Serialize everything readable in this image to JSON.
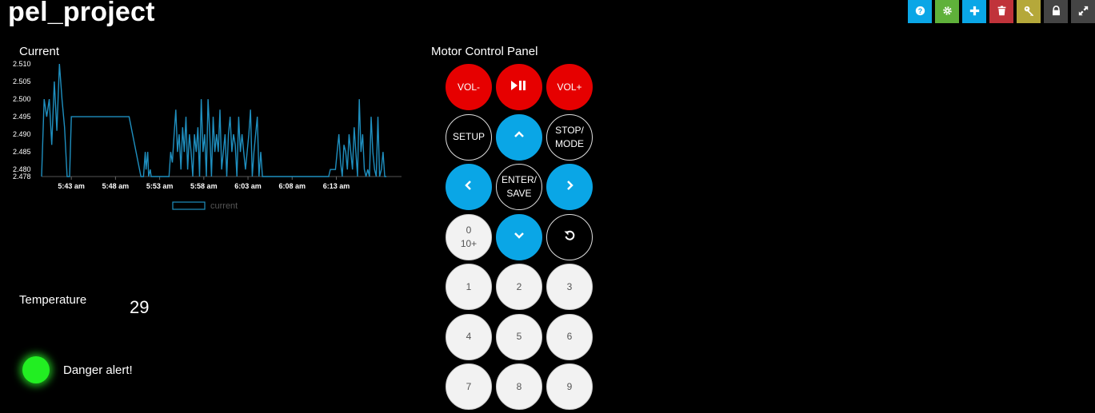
{
  "app": {
    "title": "pel_project"
  },
  "toolbar": [
    {
      "name": "help-button",
      "icon": "help-icon",
      "color": "#0aa6e6"
    },
    {
      "name": "settings-button",
      "icon": "gear-icon",
      "color": "#5fb13a"
    },
    {
      "name": "add-button",
      "icon": "plus-icon",
      "color": "#0aa6e6"
    },
    {
      "name": "delete-button",
      "icon": "trash-icon",
      "color": "#c0333a"
    },
    {
      "name": "key-button",
      "icon": "key-icon",
      "color": "#b5a83a"
    },
    {
      "name": "lock-button",
      "icon": "lock-icon",
      "color": "#444444"
    },
    {
      "name": "fullscreen-button",
      "icon": "expand-icon",
      "color": "#444444"
    }
  ],
  "current_widget": {
    "title": "Current"
  },
  "chart_data": {
    "type": "line",
    "ylim": [
      2.478,
      2.51
    ],
    "y_ticks": [
      "2.510",
      "2.505",
      "2.500",
      "2.495",
      "2.490",
      "2.485",
      "2.480",
      "2.478"
    ],
    "x_ticks": [
      "5:43 am",
      "5:48 am",
      "5:53 am",
      "5:58 am",
      "6:03 am",
      "6:08 am",
      "6:13 am"
    ],
    "series": [
      {
        "name": "current",
        "color": "#1f8fbf",
        "x_minutes": [
          0,
          0.3,
          0.6,
          0.9,
          1.2,
          1.5,
          1.8,
          2.1,
          2.4,
          2.7,
          3.0,
          3.3,
          3.5,
          3.7,
          3.9,
          4.1,
          4.3,
          4.5,
          4.7,
          4.9,
          5.1,
          5.4,
          5.5,
          10.2,
          10.3,
          11.7,
          11.8,
          12.0,
          12.2,
          12.3,
          12.5,
          12.6,
          12.8,
          12.9,
          15.0,
          15.2,
          15.4,
          15.6,
          15.8,
          16.0,
          16.2,
          16.4,
          16.6,
          16.8,
          17.0,
          17.2,
          17.4,
          17.6,
          17.8,
          18.0,
          18.2,
          18.4,
          18.6,
          18.8,
          19.0,
          19.2,
          19.4,
          19.6,
          19.8,
          20.0,
          20.2,
          20.4,
          20.6,
          20.8,
          21.0,
          21.2,
          21.4,
          21.6,
          21.8,
          22.0,
          22.2,
          22.4,
          22.6,
          22.8,
          23.0,
          23.2,
          23.4,
          23.6,
          23.8,
          24.0,
          24.2,
          24.4,
          24.6,
          24.8,
          25.0,
          25.2,
          25.4,
          25.6,
          25.8,
          26.0,
          26.2,
          26.4,
          26.6,
          26.8,
          27.0,
          27.2,
          27.4,
          27.6,
          27.8,
          28.0,
          28.2,
          28.4,
          28.6,
          28.8,
          33.8,
          34.0,
          34.2,
          34.4,
          34.6,
          34.8,
          35.0,
          35.2,
          35.4,
          35.6,
          35.8,
          36.0,
          36.2,
          36.4,
          36.6,
          36.8,
          37.0,
          37.2,
          37.4,
          37.6,
          37.8,
          38.0,
          38.2,
          38.4,
          38.6,
          38.8,
          39.0,
          39.2,
          39.4,
          39.6,
          39.8,
          40.0,
          40.2,
          40.4,
          40.6
        ],
        "values": [
          2.478,
          2.5,
          2.495,
          2.5,
          2.487,
          2.505,
          2.491,
          2.51,
          2.5,
          2.492,
          2.478,
          2.478,
          2.495,
          2.495,
          2.495,
          2.495,
          2.495,
          2.495,
          2.495,
          2.495,
          2.495,
          2.495,
          2.495,
          2.495,
          2.495,
          2.478,
          2.478,
          2.478,
          2.485,
          2.48,
          2.485,
          2.478,
          2.48,
          2.478,
          2.478,
          2.485,
          2.482,
          2.49,
          2.497,
          2.485,
          2.49,
          2.48,
          2.492,
          2.485,
          2.495,
          2.48,
          2.49,
          2.485,
          2.478,
          2.49,
          2.485,
          2.492,
          2.478,
          2.5,
          2.485,
          2.49,
          2.478,
          2.5,
          2.49,
          2.478,
          2.495,
          2.485,
          2.49,
          2.485,
          2.497,
          2.48,
          2.485,
          2.49,
          2.478,
          2.49,
          2.495,
          2.485,
          2.49,
          2.487,
          2.478,
          2.495,
          2.485,
          2.49,
          2.485,
          2.48,
          2.485,
          2.49,
          2.497,
          2.478,
          2.485,
          2.49,
          2.495,
          2.478,
          2.485,
          2.478,
          2.478,
          2.478,
          2.478,
          2.478,
          2.478,
          2.478,
          2.478,
          2.478,
          2.478,
          2.478,
          2.478,
          2.478,
          2.478,
          2.478,
          2.478,
          2.48,
          2.48,
          2.48,
          2.48,
          2.485,
          2.49,
          2.482,
          2.478,
          2.487,
          2.485,
          2.48,
          2.49,
          2.485,
          2.48,
          2.492,
          2.485,
          2.478,
          2.5,
          2.485,
          2.49,
          2.48,
          2.478,
          2.48,
          2.478,
          2.495,
          2.485,
          2.48,
          2.478,
          2.495,
          2.478,
          2.48,
          2.485,
          2.478,
          2.478
        ]
      }
    ],
    "legend": "bottom-center",
    "grid": false
  },
  "temperature": {
    "title": "Temperature",
    "value": "29"
  },
  "alert": {
    "label": "Danger alert!",
    "state_color": "#22ee22"
  },
  "motor_panel": {
    "title": "Motor Control Panel",
    "keys": [
      {
        "name": "vol-down-button",
        "label": "VOL-",
        "style": "red"
      },
      {
        "name": "play-pause-button",
        "label": "",
        "icon": "play-pause-icon",
        "style": "red"
      },
      {
        "name": "vol-up-button",
        "label": "VOL+",
        "style": "red"
      },
      {
        "name": "setup-button",
        "label": "SETUP",
        "style": "black"
      },
      {
        "name": "up-button",
        "label": "",
        "icon": "chevron-up-icon",
        "style": "blue"
      },
      {
        "name": "stop-mode-button",
        "label": "STOP/\nMODE",
        "style": "black"
      },
      {
        "name": "left-button",
        "label": "",
        "icon": "chevron-left-icon",
        "style": "blue"
      },
      {
        "name": "enter-save-button",
        "label": "ENTER/\nSAVE",
        "style": "black"
      },
      {
        "name": "right-button",
        "label": "",
        "icon": "chevron-right-icon",
        "style": "blue"
      },
      {
        "name": "zero-ten-button",
        "label": "0\n10+",
        "style": "white"
      },
      {
        "name": "down-button",
        "label": "",
        "icon": "chevron-down-icon",
        "style": "blue"
      },
      {
        "name": "return-button",
        "label": "",
        "icon": "return-icon",
        "style": "black"
      },
      {
        "name": "key-1-button",
        "label": "1",
        "style": "white"
      },
      {
        "name": "key-2-button",
        "label": "2",
        "style": "white"
      },
      {
        "name": "key-3-button",
        "label": "3",
        "style": "white"
      },
      {
        "name": "key-4-button",
        "label": "4",
        "style": "white"
      },
      {
        "name": "key-5-button",
        "label": "5",
        "style": "white"
      },
      {
        "name": "key-6-button",
        "label": "6",
        "style": "white"
      },
      {
        "name": "key-7-button",
        "label": "7",
        "style": "white"
      },
      {
        "name": "key-8-button",
        "label": "8",
        "style": "white"
      },
      {
        "name": "key-9-button",
        "label": "9",
        "style": "white"
      }
    ]
  }
}
